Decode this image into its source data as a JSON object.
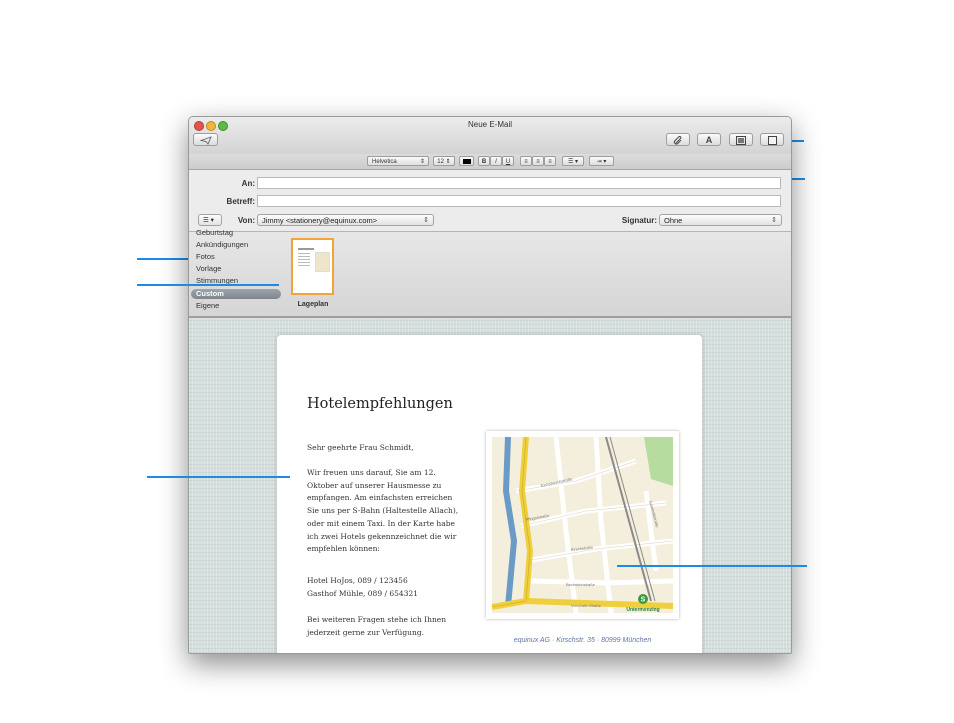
{
  "window": {
    "title": "Neue E-Mail"
  },
  "toolbar": {
    "send_icon": "paper-plane-icon",
    "attach_icon": "paperclip-icon",
    "fonts_label": "A",
    "photo_icon": "photo-browser-icon",
    "stationery_icon": "stationery-icon"
  },
  "format_bar": {
    "font": "Helvetica",
    "size": "12",
    "bold": "B",
    "italic": "I",
    "underline": "U"
  },
  "headers": {
    "to_label": "An:",
    "to_value": "",
    "subject_label": "Betreff:",
    "subject_value": "",
    "from_label": "Von:",
    "from_value": "Jimmy <stationery@equinux.com>",
    "signature_label": "Signatur:",
    "signature_value": "Ohne",
    "menu_label": "☰ ▾"
  },
  "stationery": {
    "categories": [
      "Geburtstag",
      "Ankündigungen",
      "Fotos",
      "Vorlage",
      "Stimmungen",
      "Custom",
      "Eigene"
    ],
    "selected": "Custom",
    "templates": [
      {
        "label": "Lageplan"
      }
    ]
  },
  "letter": {
    "heading": "Hotelempfehlungen",
    "greeting": "Sehr geehrte Frau  Schmidt,",
    "paragraph1": "Wir freuen uns darauf, Sie am 12. Oktober auf unserer Hausmesse zu empfangen. Am einfachsten erreichen Sie uns per S-Bahn (Haltestelle Allach), oder mit einem Taxi. In der Karte habe ich zwei Hotels gekennzeichnet die wir empfehlen können:",
    "hotel1": "Hotel HoJos, 089 / 123456",
    "hotel2": "Gasthof Mühle, 089 / 654321",
    "paragraph2": "Bei weiteren Fragen stehe ich Ihnen jederzeit gerne zur Verfügung.",
    "footer": "equinux AG · Kirschstr. 35 · 80999 München"
  },
  "map": {
    "streets": [
      "Eversbuschstraße",
      "Pfingststraße",
      "Kirschstraße",
      "Bechsteinstraße",
      "Von-Kahr-Straße",
      "Goteboldstraße"
    ],
    "station": "Untermenzing",
    "station_badge": "S"
  },
  "colors": {
    "callout": "#1e8ae6",
    "thumb_highlight": "#f2a33a",
    "category_selected": "#8a9099"
  }
}
